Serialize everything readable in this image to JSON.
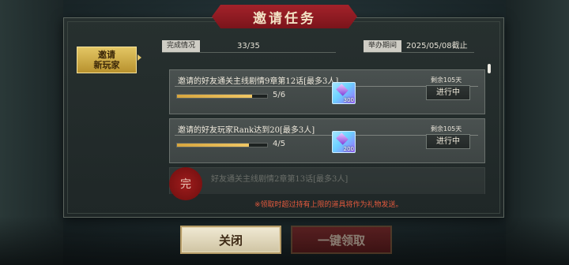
{
  "title": "邀请任务",
  "tab": {
    "line1": "邀请",
    "line2": "新玩家"
  },
  "info": {
    "completion_label": "完成情况",
    "completion_value": "33/35",
    "period_label": "举办期间",
    "period_value": "2025/05/08截止"
  },
  "tasks": [
    {
      "title": "邀请的好友通关主线剧情9章第12话[最多3人]",
      "progress": "5/6",
      "progress_fraction": 0.83,
      "reward_qty": "300",
      "remain": "剩余105天",
      "status": "进行中"
    },
    {
      "title": "邀请的好友玩家Rank达到20[最多3人]",
      "progress": "4/5",
      "progress_fraction": 0.8,
      "reward_qty": "200",
      "remain": "剩余105天",
      "status": "进行中"
    },
    {
      "title": "好友通关主线剧情2章第13话[最多3人]"
    }
  ],
  "seal_text": "完",
  "notice": "※领取时超过持有上限的道具将作为礼物发送。",
  "buttons": {
    "close": "关闭",
    "claim_all": "一键领取"
  },
  "colors": {
    "title_banner": "#8e1b22",
    "tab_gold": "#d9b553",
    "notice": "#e55a3e",
    "progress_fill": "#e1b04b"
  },
  "icons": {
    "reward": "gem-ticket-icon",
    "tab_arrow": "caret-right-icon"
  }
}
